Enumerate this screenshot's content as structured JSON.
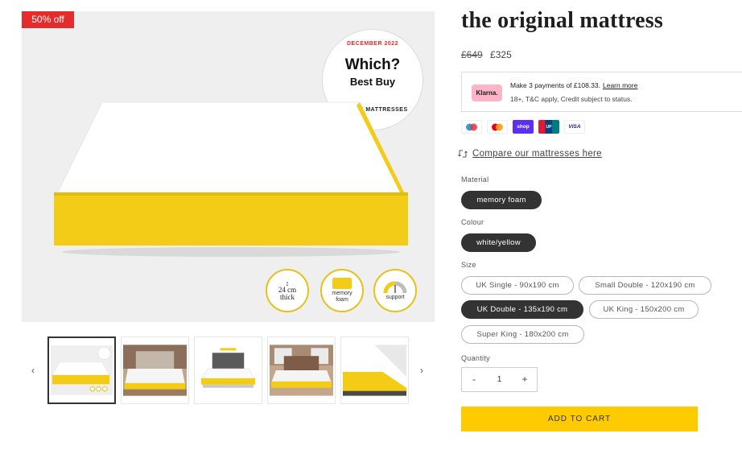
{
  "gallery": {
    "sale_badge": "50% off",
    "seal": {
      "date": "DECEMBER 2022",
      "which": "Which?",
      "best_buy": "Best Buy",
      "category": "DOUBLE MATTRESSES"
    },
    "features": [
      {
        "line1": "24 cm",
        "line2": "thick",
        "icon": "height-arrow-icon"
      },
      {
        "line1": "memory",
        "line2": "foam",
        "icon": "memory-foam-icon"
      },
      {
        "line1": "support",
        "line2": "",
        "icon": "support-gauge-icon"
      }
    ],
    "prev_icon": "‹",
    "next_icon": "›",
    "thumbnails_count": 5
  },
  "product": {
    "title": "the original mattress",
    "old_price": "£649",
    "price": "£325",
    "klarna": {
      "logo": "Klarna.",
      "line1": "Make 3 payments of £108.33.",
      "learn_more": "Learn more",
      "line2": "18+, T&C apply, Credit subject to status."
    },
    "payment_methods": [
      "Maestro",
      "Mastercard",
      "shop",
      "UnionPay",
      "VISA"
    ],
    "compare_link": "Compare our mattresses here",
    "material": {
      "label": "Material",
      "options": [
        "memory foam"
      ],
      "selected": "memory foam"
    },
    "colour": {
      "label": "Colour",
      "options": [
        "white/yellow"
      ],
      "selected": "white/yellow"
    },
    "size": {
      "label": "Size",
      "options": [
        "UK Single - 90x190 cm",
        "Small Double - 120x190 cm",
        "UK Double - 135x190 cm",
        "UK King - 150x200 cm",
        "Super King - 180x200 cm"
      ],
      "selected": "UK Double - 135x190 cm"
    },
    "quantity": {
      "label": "Quantity",
      "value": "1",
      "minus": "-",
      "plus": "+"
    },
    "add_to_cart": "ADD TO CART"
  },
  "colors": {
    "sale_red": "#e42c2c",
    "mattress_yellow": "#f2cc16",
    "cart_yellow": "#fecb00",
    "pill_selected": "#333333",
    "klarna_pink": "#ffb3c7"
  }
}
